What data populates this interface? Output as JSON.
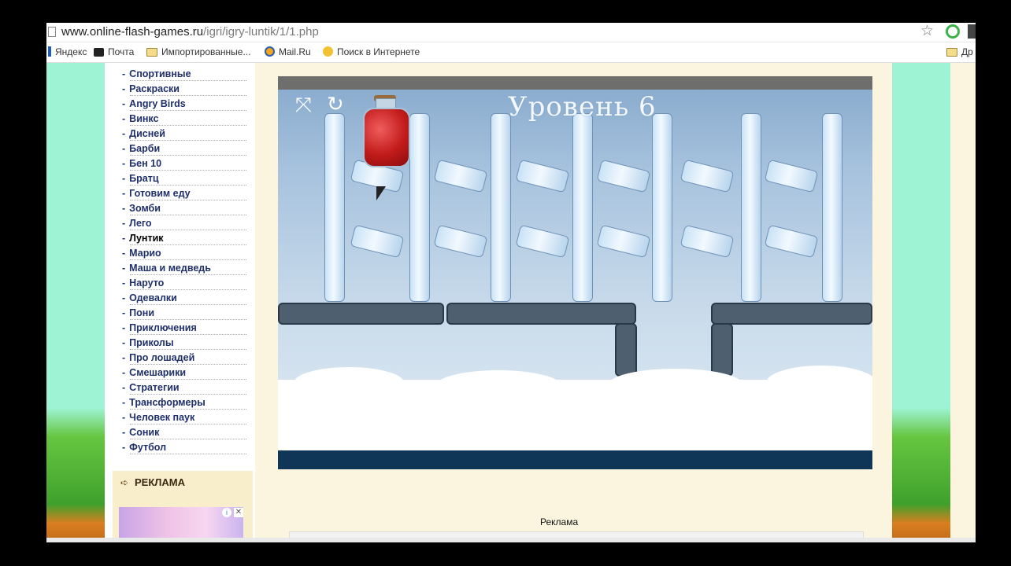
{
  "browser": {
    "url_host": "www.online-flash-games.ru",
    "url_path": "/igri/igry-luntik/1/1.php",
    "star_icon": "star-icon",
    "bookmarks": [
      {
        "label": "Яндекс",
        "icon": "yandex-icon"
      },
      {
        "label": "Почта",
        "icon": "mail-icon"
      },
      {
        "label": "Импортированные...",
        "icon": "folder-icon"
      },
      {
        "label": "Mail.Ru",
        "icon": "mailru-icon"
      },
      {
        "label": "Поиск в Интернете",
        "icon": "search-key-icon"
      },
      {
        "label": "Др",
        "icon": "folder-icon"
      }
    ]
  },
  "sidebar": {
    "categories": [
      "Спортивные",
      "Раскраски",
      "Angry Birds",
      "Винкс",
      "Дисней",
      "Барби",
      "Бен 10",
      "Братц",
      "Готовим еду",
      "Зомби",
      "Лего",
      "Лунтик",
      "Марио",
      "Маша и медведь",
      "Наруто",
      "Одевалки",
      "Пони",
      "Приключения",
      "Приколы",
      "Про лошадей",
      "Смешарики",
      "Стратегии",
      "Трансформеры",
      "Человек паук",
      "Соник",
      "Футбол"
    ],
    "ad_title": "РЕКЛАМА"
  },
  "game": {
    "level_text": "Уровень 6"
  },
  "main": {
    "ad_label": "Реклама"
  }
}
